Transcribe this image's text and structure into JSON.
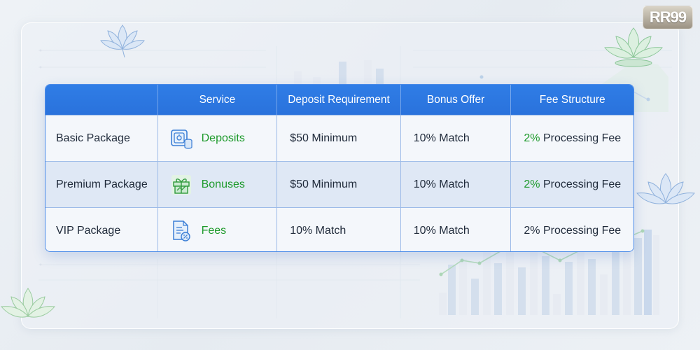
{
  "logo": {
    "text": "RR99"
  },
  "table": {
    "headers": [
      "",
      "Service",
      "Deposit Requirement",
      "Bonus Offer",
      "Fee Structure"
    ],
    "rows": [
      {
        "package": "Basic Package",
        "service": "Deposits",
        "service_icon": "vault-coins-icon",
        "deposit": "$50 Minimum",
        "bonus": "10% Match",
        "fee_pct": "2%",
        "fee_rest": " Processing Fee",
        "fee_pct_color": "#1d9a2b"
      },
      {
        "package": "Premium Package",
        "service": "Bonuses",
        "service_icon": "gift-box-icon",
        "deposit": "$50 Minimum",
        "bonus": "10% Match",
        "fee_pct": "2%",
        "fee_rest": " Processing Fee",
        "fee_pct_color": "#1d9a2b"
      },
      {
        "package": "VIP Package",
        "service": "Fees",
        "service_icon": "fee-document-icon",
        "deposit": "10% Match",
        "bonus": "10% Match",
        "fee_pct": "2%",
        "fee_rest": " Processing Fee",
        "fee_pct_color": "#1f2a3a"
      }
    ]
  },
  "colors": {
    "header_blue": "#2f7de6",
    "accent_green": "#1d9a2b",
    "border_blue": "#4c8ce8"
  }
}
